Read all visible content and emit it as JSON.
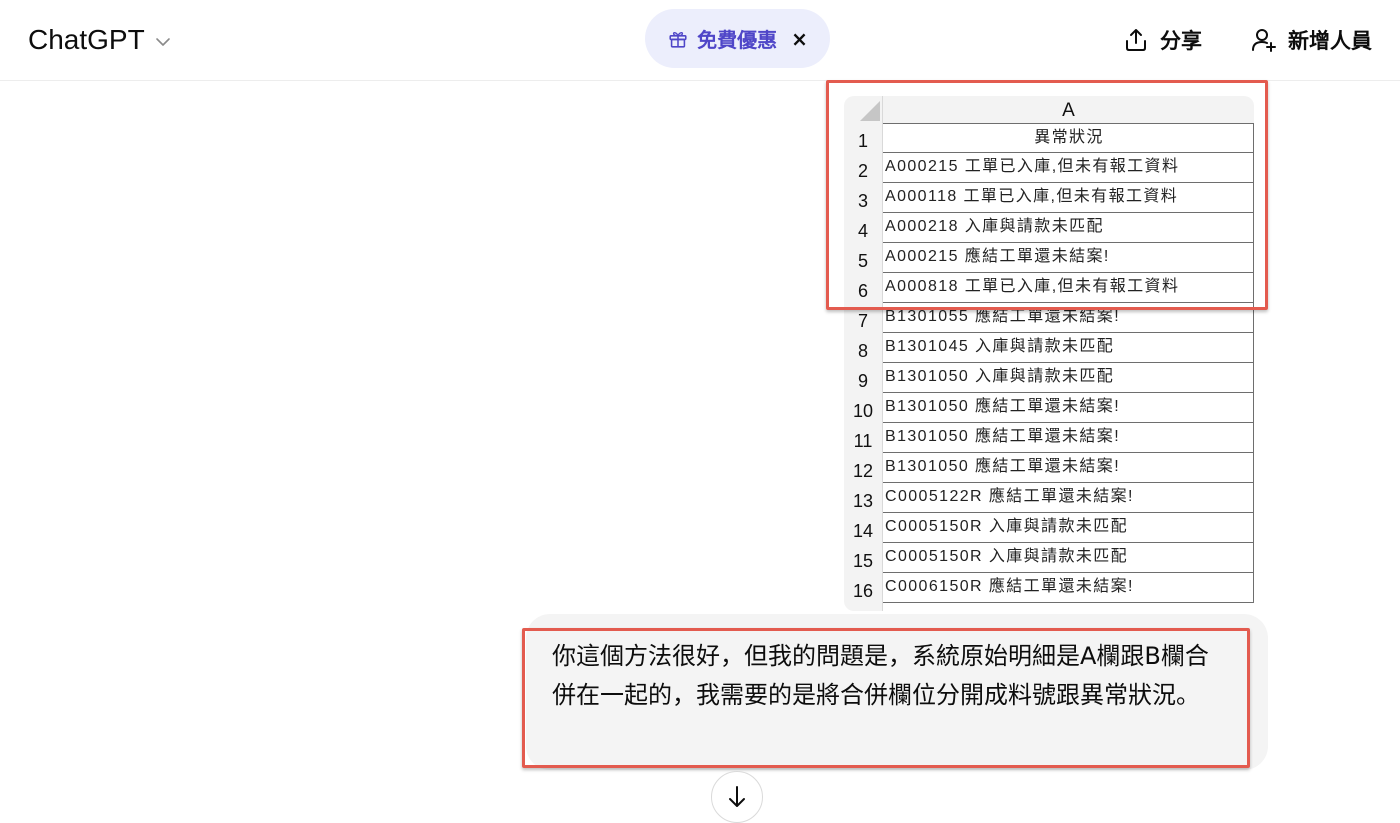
{
  "header": {
    "model_name": "ChatGPT",
    "promo_label": "免費優惠",
    "promo_close": "×",
    "share_label": "分享",
    "invite_label": "新增人員"
  },
  "spreadsheet": {
    "column_header": "A",
    "rows": [
      {
        "num": "1",
        "text": "異常狀況"
      },
      {
        "num": "2",
        "text": "A000215 工單已入庫,但未有報工資料"
      },
      {
        "num": "3",
        "text": "A000118 工單已入庫,但未有報工資料"
      },
      {
        "num": "4",
        "text": "A000218 入庫與請款未匹配"
      },
      {
        "num": "5",
        "text": "A000215 應結工單還未結案!"
      },
      {
        "num": "6",
        "text": "A000818 工單已入庫,但未有報工資料"
      },
      {
        "num": "7",
        "text": "B1301055 應結工單還未結案!"
      },
      {
        "num": "8",
        "text": "B1301045 入庫與請款未匹配"
      },
      {
        "num": "9",
        "text": "B1301050 入庫與請款未匹配"
      },
      {
        "num": "10",
        "text": "B1301050 應結工單還未結案!"
      },
      {
        "num": "11",
        "text": "B1301050 應結工單還未結案!"
      },
      {
        "num": "12",
        "text": "B1301050 應結工單還未結案!"
      },
      {
        "num": "13",
        "text": "C0005122R 應結工單還未結案!"
      },
      {
        "num": "14",
        "text": "C0005150R 入庫與請款未匹配"
      },
      {
        "num": "15",
        "text": "C0005150R 入庫與請款未匹配"
      },
      {
        "num": "16",
        "text": "C0006150R 應結工單還未結案!"
      }
    ]
  },
  "user_message": {
    "text": "你這個方法很好，但我的問題是，系統原始明細是A欄跟B欄合併在一起的，我需要的是將合併欄位分開成料號跟異常狀況。"
  },
  "colors": {
    "highlight": "#e35b4f",
    "promo_bg": "#eceefc",
    "promo_text": "#4f46c8",
    "bubble_bg": "#f4f4f4"
  },
  "icons": {
    "model_chevron": "chevron-down-icon",
    "promo": "gift-icon",
    "share": "share-icon",
    "invite": "add-person-icon",
    "scroll": "arrow-down-icon"
  }
}
